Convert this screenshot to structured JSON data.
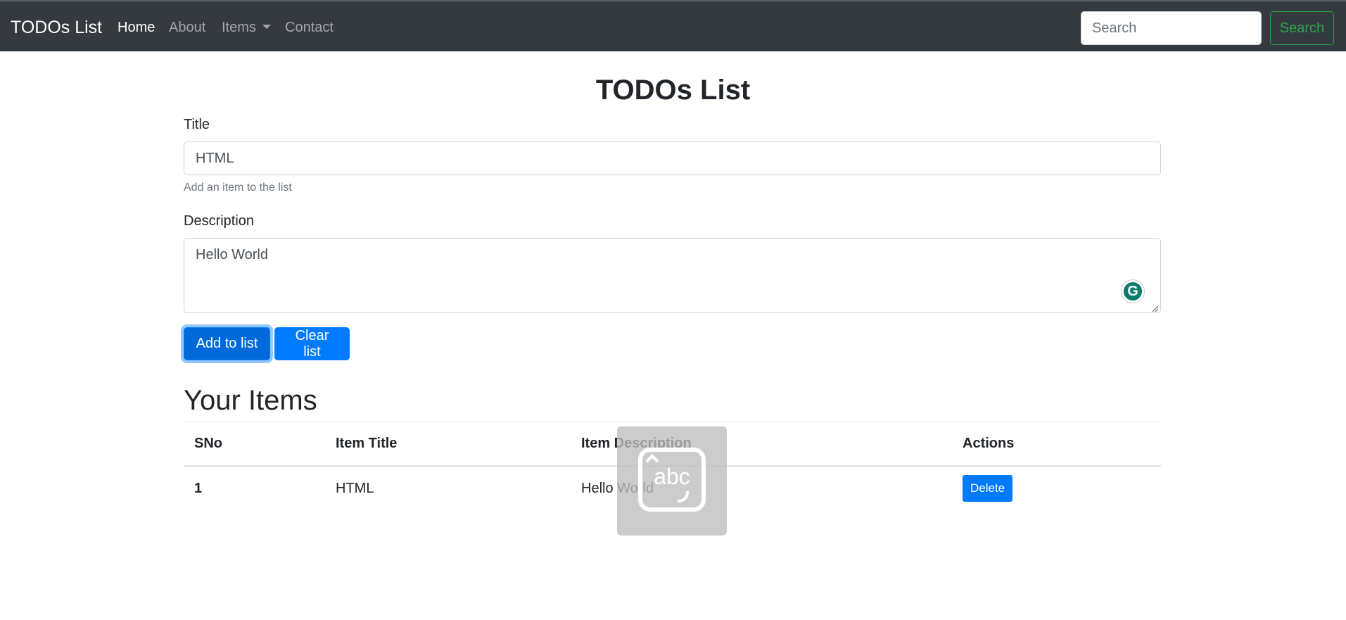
{
  "navbar": {
    "brand": "TODOs List",
    "links": [
      {
        "label": "Home",
        "active": true
      },
      {
        "label": "About",
        "active": false
      },
      {
        "label": "Items",
        "active": false,
        "dropdown": true
      },
      {
        "label": "Contact",
        "active": false
      }
    ],
    "search": {
      "placeholder": "Search",
      "value": "",
      "button_label": "Search"
    }
  },
  "page": {
    "title": "TODOs List"
  },
  "form": {
    "title_label": "Title",
    "title_value": "HTML",
    "title_help": "Add an item to the list",
    "description_label": "Description",
    "description_value": "Hello World",
    "add_button": "Add to list",
    "clear_button": "Clear list"
  },
  "items_section": {
    "title": "Your Items",
    "columns": [
      "SNo",
      "Item Title",
      "Item Description",
      "Actions"
    ],
    "rows": [
      {
        "sno": "1",
        "title": "HTML",
        "description": "Hello World",
        "action_label": "Delete"
      }
    ]
  },
  "overlay": {
    "icon": "handwriting-keyboard-icon",
    "text": "abc"
  },
  "colors": {
    "navbar": "#343a40",
    "primary": "#007bff",
    "success": "#28a745"
  }
}
